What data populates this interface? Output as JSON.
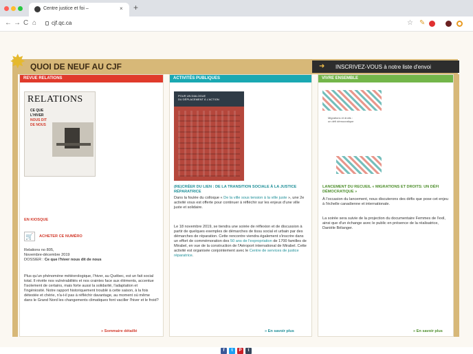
{
  "browser": {
    "tab_title": "Centre justice et foi –",
    "tab_close": "×",
    "new_tab": "+",
    "url": "cjf.qc.ca",
    "nav": {
      "back": "←",
      "forward": "→",
      "reload": "C",
      "home": "⌂"
    }
  },
  "header": {
    "section_title": "QUOI DE NEUF AU CJF",
    "newsletter_label": "INSCRIVEZ-VOUS à notre liste d'envoi",
    "accent_color": "#d7b878"
  },
  "card1": {
    "header": "REVUE RELATIONS",
    "color": "#e03a2b",
    "cover_title": "RELATIONS",
    "cover_lines": [
      "CE QUE",
      "L'HIVER",
      "NOUS DIT",
      "DE NOUS"
    ],
    "kiosk_label": "EN KIOSQUE",
    "buy_label": "ACHETER CE NUMÉRO",
    "issue_line1": "Relations no 805,",
    "issue_line2": "Novembre-décembre 2019",
    "dossier_prefix": "DOSSIER : ",
    "dossier_title": "Ce que l'hiver nous dit de nous",
    "body": "Plus qu'un phénomène météorologique, l'hiver, au Québec, est un fait social total. Il révèle nos vulnérabilités et nos craintes face aux éléments, accentue l'isolement de certains, mais forte aussi la solidarité, l'adaptation et l'ingéniosité. Notre rapport historiquement troublé à cette saison, à la fois détestée et chérie, n'a-t-il pas à réfléchir davantage, au moment où même dans le Grand Nord les changements climatiques font vaciller l'hiver et le froid?",
    "more": "» Sommaire détaillé"
  },
  "card2": {
    "header": "ACTIVITÉS PUBLIQUES",
    "color": "#1aa8b2",
    "poster_lines": [
      "POUR UN DIALOGUE",
      "DU DÉPLACEMENT À L'ACTION"
    ],
    "title": "(RE)CRÉER DU LIEN : DE LA TRANSITION SOCIALE À LA JUSTICE RÉPARATRICE",
    "p1_a": "Dans la foulée du colloque « ",
    "p1_link": "De la ville sous tension à la ville juste",
    "p1_b": " », une 2e activité vous est offerte pour continuer à réfléchir sur les enjeux d'une ville juste et solidaire.",
    "p2_a": "Le 18 novembre 2019, se tiendra une soirée de réflexion et de discussion à partir de quelques exemples de démarches de tissu social et urbain par des démarches de réparation. Cette rencontre viendra également s'inscrire dans un effort de commémoration des ",
    "p2_link": "50 ans de l'expropriation",
    "p2_b": " de 1700 familles de Mirabel, en vue de la construction de l'Aéroport international de Mirabel. Cette activité est organisée conjointement avec le ",
    "p2_link2": "Centre de services de justice réparatrice",
    "p2_c": ".",
    "more": "» En savoir plus"
  },
  "card3": {
    "header": "VIVRE ENSEMBLE",
    "color": "#73b64a",
    "book_lines": [
      "Migrations et droits :",
      "un défi démocratique"
    ],
    "title": "LANCEMENT DU RECUEIL « MIGRATIONS ET DROITS: UN DÉFI DÉMOCRATIQUE »",
    "p1": "À l'occasion du lancement, nous discuterons des défis que pose cet enjeu à l'échelle canadienne et internationale.",
    "p2": "La soirée sera suivie de la projection du documentaire Femmes de l'exil, ainsi que d'un échange avec le public en présence de la réalisatrice, Danièle Bélanger.",
    "more": "» En savoir plus"
  },
  "social": {
    "facebook": "f",
    "twitter": "t",
    "pinterest": "P",
    "tumblr": "t"
  }
}
